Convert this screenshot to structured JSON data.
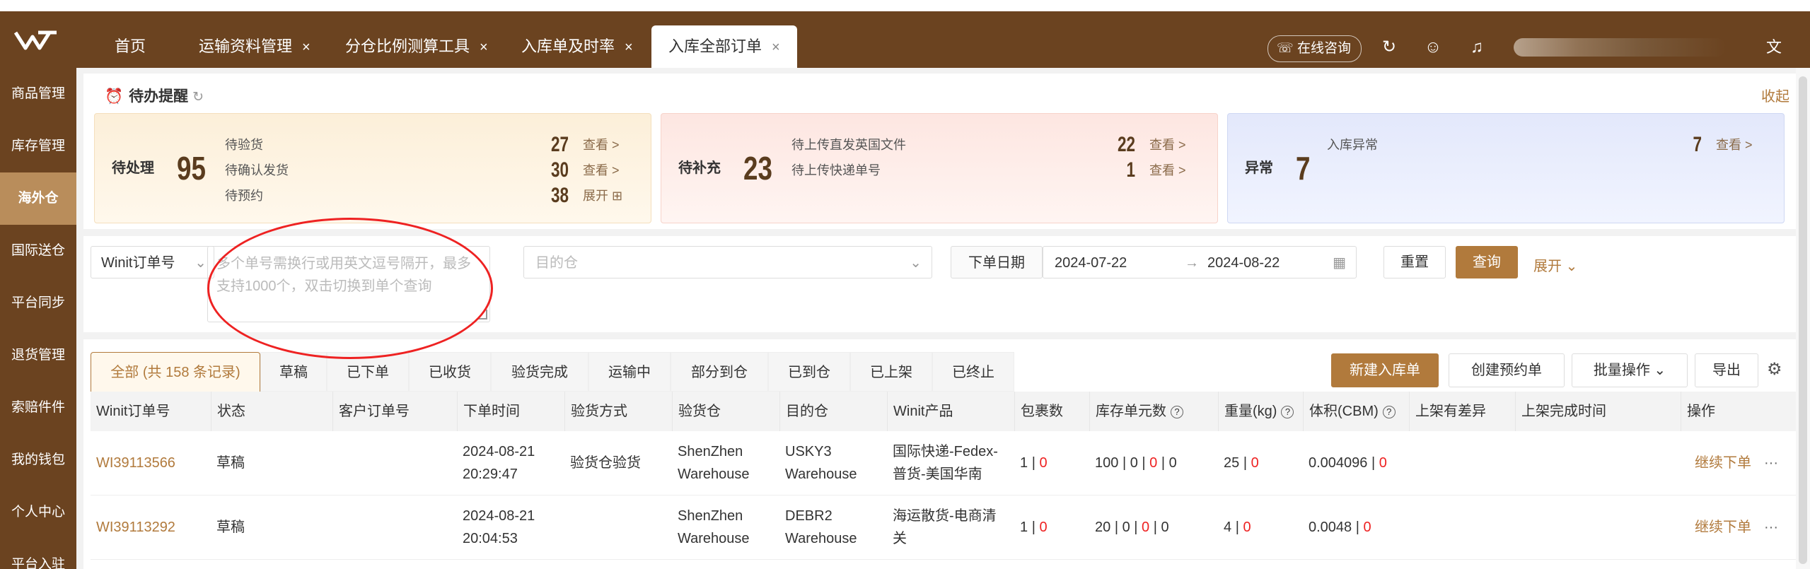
{
  "header": {
    "tabs": [
      {
        "label": "首页",
        "closable": false
      },
      {
        "label": "运输资料管理",
        "closable": true
      },
      {
        "label": "分仓比例测算工具",
        "closable": true
      },
      {
        "label": "入库单及时率",
        "closable": true
      },
      {
        "label": "入库全部订单",
        "closable": true,
        "active": true
      }
    ],
    "close_glyph": "×",
    "consult_label": "在线咨询",
    "icons": [
      "refresh-icon",
      "smile-icon",
      "bell-icon",
      "translate-icon"
    ]
  },
  "sidebar": {
    "items": [
      {
        "label": "商品管理"
      },
      {
        "label": "库存管理"
      },
      {
        "label": "海外仓",
        "active": true
      },
      {
        "label": "国际送仓"
      },
      {
        "label": "平台同步"
      },
      {
        "label": "退货管理"
      },
      {
        "label": "索赔件件"
      },
      {
        "label": "我的钱包"
      },
      {
        "label": "个人中心"
      },
      {
        "label": "平台入驻"
      }
    ]
  },
  "todo": {
    "title": "待办提醒",
    "collapse_label": "收起",
    "cards": [
      {
        "label": "待处理",
        "total": "95",
        "rows": [
          {
            "label": "待验货",
            "count": "27",
            "action": "查看 >"
          },
          {
            "label": "待确认发货",
            "count": "30",
            "action": "查看 >"
          },
          {
            "label": "待预约",
            "count": "38",
            "action": "展开 ⊞"
          }
        ]
      },
      {
        "label": "待补充",
        "total": "23",
        "rows": [
          {
            "label": "待上传直发英国文件",
            "count": "22",
            "action": "查看 >"
          },
          {
            "label": "待上传快递单号",
            "count": "1",
            "action": "查看 >"
          }
        ]
      },
      {
        "label": "异常",
        "total": "7",
        "rows": [
          {
            "label": "入库异常",
            "count": "7",
            "action": "查看 >"
          }
        ]
      }
    ],
    "colors": {
      "card1": "#fcefd9",
      "card2": "#fde6e1",
      "card3": "#e3e8fb"
    }
  },
  "filters": {
    "order_type_select": "Winit订单号",
    "order_input_placeholder": "多个单号需换行或用英文逗号隔开，最多支持1000个，双击切换到单个查询",
    "dest_warehouse_placeholder": "目的仓",
    "date_label": "下单日期",
    "date_start": "2024-07-22",
    "date_arrow": "→",
    "date_end": "2024-08-22",
    "reset_label": "重置",
    "query_label": "查询",
    "expand_label": "展开"
  },
  "status_tabs": [
    {
      "label": "全部 (共 158 条记录)",
      "active": true
    },
    {
      "label": "草稿"
    },
    {
      "label": "已下单"
    },
    {
      "label": "已收货"
    },
    {
      "label": "验货完成"
    },
    {
      "label": "运输中"
    },
    {
      "label": "部分到仓"
    },
    {
      "label": "已到仓"
    },
    {
      "label": "已上架"
    },
    {
      "label": "已终止"
    }
  ],
  "toolbar": {
    "new_inbound_label": "新建入库单",
    "create_appointment_label": "创建预约单",
    "batch_ops_label": "批量操作",
    "export_label": "导出"
  },
  "table": {
    "headers": [
      "Winit订单号",
      "状态",
      "客户订单号",
      "下单时间",
      "验货方式",
      "验货仓",
      "目的仓",
      "Winit产品",
      "包裹数",
      "库存单元数",
      "重量(kg)",
      "体积(CBM)",
      "上架有差异",
      "上架完成时间",
      "操作"
    ],
    "rows": [
      {
        "order_no": "WI39113566",
        "status": "草稿",
        "customer_no": "",
        "time_date": "2024-08-21",
        "time_clock": "20:29:47",
        "inspect_method": "验货仓验货",
        "inspect_wh_1": "ShenZhen",
        "inspect_wh_2": "Warehouse",
        "dest_wh_1": "USKY3",
        "dest_wh_2": "Warehouse",
        "product_1": "国际快递-Fedex-",
        "product_2": "普货-美国华南",
        "pkg_a": "1",
        "pkg_b": "0",
        "sku_a": "100",
        "sku_b": "0",
        "sku_c": "0",
        "sku_d": "0",
        "weight_a": "25",
        "weight_b": "0",
        "volume_a": "0.004096",
        "volume_b": "0",
        "diff": "",
        "finish_time": "",
        "action": "继续下单",
        "more": "···"
      },
      {
        "order_no": "WI39113292",
        "status": "草稿",
        "customer_no": "",
        "time_date": "2024-08-21",
        "time_clock": "20:04:53",
        "inspect_method": "",
        "inspect_wh_1": "ShenZhen",
        "inspect_wh_2": "Warehouse",
        "dest_wh_1": "DEBR2",
        "dest_wh_2": "Warehouse",
        "product_1": "海运散货-电商清",
        "product_2": "关",
        "pkg_a": "1",
        "pkg_b": "0",
        "sku_a": "20",
        "sku_b": "0",
        "sku_c": "0",
        "sku_d": "0",
        "weight_a": "4",
        "weight_b": "0",
        "volume_a": "0.0048",
        "volume_b": "0",
        "diff": "",
        "finish_time": "",
        "action": "继续下单",
        "more": "···"
      }
    ],
    "sep": "|"
  },
  "colors": {
    "brand": "#6b4320",
    "accent": "#b17a3c",
    "danger": "#e22222"
  }
}
